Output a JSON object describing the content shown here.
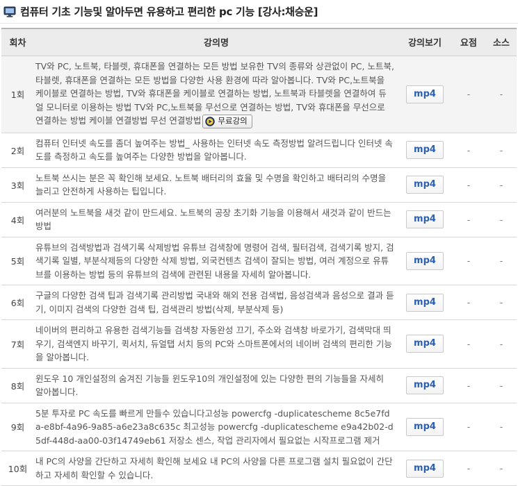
{
  "page": {
    "title": "컴퓨터 기초 기능및 알아두면 유용하고 편리한 pc 기능 [강사:채승운]",
    "icon": "monitor-icon"
  },
  "table": {
    "headers": {
      "num": "회차",
      "title": "강의명",
      "view": "강의보기",
      "summary": "요점",
      "source": "소스"
    },
    "rows": [
      {
        "num": "1회",
        "title": "TV와 PC, 노트북, 타블렛, 휴대폰을 연결하는 모든 방법 보유한 TV의 종류와 상관없이 PC, 노트북, 타블렛, 휴대폰을 연결하는 모든 방법을 다양한 사용 환경에 따라 알아봅니다. TV와 PC,노트북을 케이블로 연결하는 방법, TV와 휴대폰을 케이블로 연결하는 방법, 노트북과 타블렛을 연결하여 듀얼 모니터로 이용하는 방법 TV와 PC,노트북을 무선으로 연결하는 방법, TV와 휴대폰을 무선으로 연결하는 방법 케이블 연결방법 무선 연결방법",
        "free": "무료강의",
        "view": "mp4",
        "summary": "-",
        "source": "-"
      },
      {
        "num": "2회",
        "title": "컴퓨터 인터넷 속도를 좀더 높여주는 방법_ 사용하는 인터넷 속도 측정방법 알려드립니다 인터넷 속도를 측정하고 속도를 높여주는 다양한 방법을 알아봅니다.",
        "view": "mp4",
        "summary": "-",
        "source": "-"
      },
      {
        "num": "3회",
        "title": "노트북 쓰시는 분은 꼭 확인해 보세요. 노트북 배터리의 효율 및 수명을 확인하고 배터리의 수명을 늘리고 안전하게 사용하는 팁입니다.",
        "view": "mp4",
        "summary": "-",
        "source": "-"
      },
      {
        "num": "4회",
        "title": "여러분의 노트북을 새것 같이 만드세요. 노트북의 공장 초기화 기능을 이용해서 새것과 같이 반드는 방법",
        "view": "mp4",
        "summary": "-",
        "source": "-"
      },
      {
        "num": "5회",
        "title": "유튜브의 검색방법과 검색기록 삭제방법 유튜브 검색창에 명령어 검색, 필터검색, 검색기록 방지, 검색기록 일별, 부분삭제등의 다양한 삭제 방법, 외국컨텐츠 검색이 잘되는 방법, 여러 계정으로 유튜브를 이용하는 방법 등의 유튜브의 검색에 관련된 내용을 자세히 알아봅니다.",
        "view": "mp4",
        "summary": "-",
        "source": "-"
      },
      {
        "num": "6회",
        "title": "구글의 다양한 검색 팁과 검색기록 관리방법 국내와 해외 전용 검색법, 음성검색과 음성으로 결과 듣기, 이미지 검색의 다양한 검색 팁, 검색관리 방법(삭제, 부분삭제 등)",
        "view": "mp4",
        "summary": "-",
        "source": "-"
      },
      {
        "num": "7회",
        "title": "네이버의 편리하고 유용한 검색기능들 검색창 자동완성 끄기, 주소와 검색창 바로가기, 검색막대 띄우기, 검색엔지 바꾸기, 퀵서치, 듀얼탭 서치 등의 PC와 스마트폰에서의 네이버 검색의 편리한 기능을 알아봅니다.",
        "view": "mp4",
        "summary": "-",
        "source": "-"
      },
      {
        "num": "8회",
        "title": "윈도우 10 개인설정의 숨겨진 기능들 윈도우10의 개인설정에 있는 다양한 편의 기능들을 자세히 알아봅니다.",
        "view": "mp4",
        "summary": "-",
        "source": "-"
      },
      {
        "num": "9회",
        "title": "5분 투자로 PC 속도를 빠르게 만들수 있습니다고성능 powercfg -duplicatescheme 8c5e7fda-e8bf-4a96-9a85-a6e23a8c635c 최고성능 powercfg -duplicatescheme e9a42b02-d5df-448d-aa00-03f14749eb61 저장소 센스, 작업 관리자에서 필요없는 시작프로그램 제거",
        "view": "mp4",
        "summary": "-",
        "source": "-"
      },
      {
        "num": "10회",
        "title": "내 PC의 사양을 간단하고 자세히 확인해 보세요 내 PC의 사양을 다른 프로그램 설치 필요없이 간단하고 자세히 확인할 수 있습니다.",
        "view": "mp4",
        "summary": "-",
        "source": "-"
      }
    ]
  }
}
